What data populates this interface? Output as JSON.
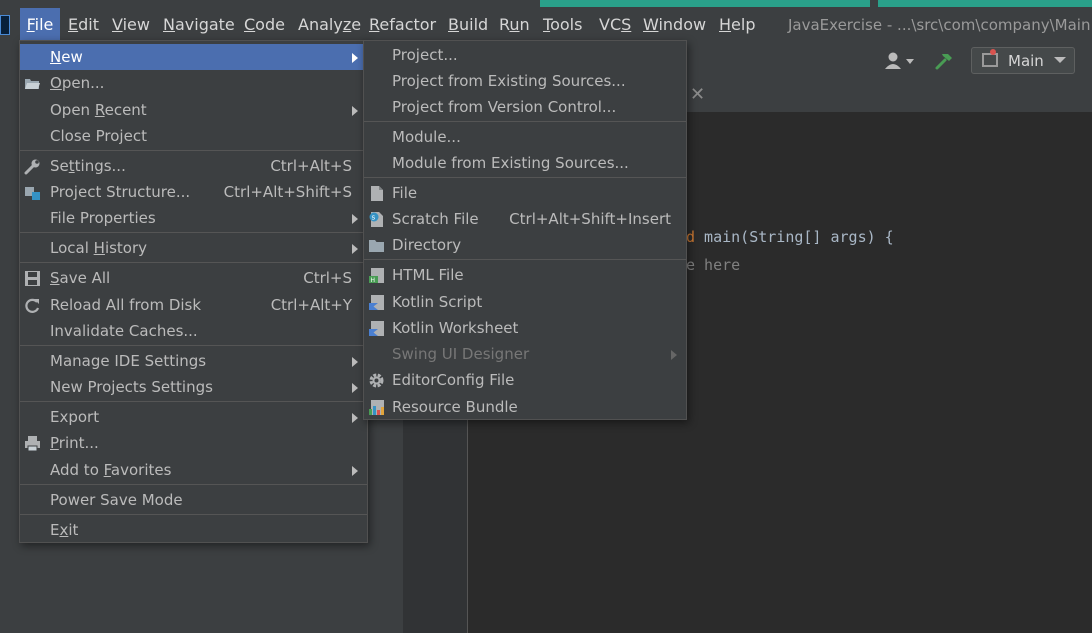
{
  "menubar": {
    "items": [
      {
        "label": "File",
        "underline": "F"
      },
      {
        "label": "Edit",
        "underline": "E"
      },
      {
        "label": "View",
        "underline": "V"
      },
      {
        "label": "Navigate",
        "underline": "N"
      },
      {
        "label": "Code",
        "underline": "C"
      },
      {
        "label": "Analyze",
        "underline": "z"
      },
      {
        "label": "Refactor",
        "underline": "R"
      },
      {
        "label": "Build",
        "underline": "B"
      },
      {
        "label": "Run",
        "underline": "u"
      },
      {
        "label": "Tools",
        "underline": "T"
      },
      {
        "label": "VCS",
        "underline": "S"
      },
      {
        "label": "Window",
        "underline": "W"
      },
      {
        "label": "Help",
        "underline": "H"
      }
    ],
    "window_title": "JavaExercise - ...\\src\\com\\company\\Main.j"
  },
  "toolbar": {
    "run_config": "Main"
  },
  "editor": {
    "code_keyword": "d",
    "code_main": " main(String[] args) {",
    "code_comment": "e here"
  },
  "file_menu": {
    "items": [
      {
        "label": "New",
        "pre": "",
        "u": "N",
        "post": "ew",
        "shortcut": "",
        "submenu": true
      },
      {
        "label": "Open...",
        "pre": "",
        "u": "O",
        "post": "pen...",
        "shortcut": "",
        "submenu": false
      },
      {
        "label": "Open Recent",
        "pre": "Open ",
        "u": "R",
        "post": "ecent",
        "shortcut": "",
        "submenu": true
      },
      {
        "label": "Close Project",
        "pre": "Close Pro",
        "u": "",
        "post": "ject",
        "shortcut": "",
        "submenu": false
      },
      {
        "label": "Settings...",
        "pre": "Se",
        "u": "t",
        "post": "tings...",
        "shortcut": "Ctrl+Alt+S",
        "submenu": false
      },
      {
        "label": "Project Structure...",
        "pre": "Project Structure...",
        "u": "",
        "post": "",
        "shortcut": "Ctrl+Alt+Shift+S",
        "submenu": false
      },
      {
        "label": "File Properties",
        "pre": "File Properties",
        "u": "",
        "post": "",
        "shortcut": "",
        "submenu": true
      },
      {
        "label": "Local History",
        "pre": "Local ",
        "u": "H",
        "post": "istory",
        "shortcut": "",
        "submenu": true
      },
      {
        "label": "Save All",
        "pre": "",
        "u": "S",
        "post": "ave All",
        "shortcut": "Ctrl+S",
        "submenu": false
      },
      {
        "label": "Reload All from Disk",
        "pre": "Reload All from Disk",
        "u": "",
        "post": "",
        "shortcut": "Ctrl+Alt+Y",
        "submenu": false
      },
      {
        "label": "Invalidate Caches...",
        "pre": "Invalidate Caches...",
        "u": "",
        "post": "",
        "shortcut": "",
        "submenu": false
      },
      {
        "label": "Manage IDE Settings",
        "pre": "Manage IDE Settings",
        "u": "",
        "post": "",
        "shortcut": "",
        "submenu": true
      },
      {
        "label": "New Projects Settings",
        "pre": "New Projects Settings",
        "u": "",
        "post": "",
        "shortcut": "",
        "submenu": true
      },
      {
        "label": "Export",
        "pre": "Export",
        "u": "",
        "post": "",
        "shortcut": "",
        "submenu": true
      },
      {
        "label": "Print...",
        "pre": "",
        "u": "P",
        "post": "rint...",
        "shortcut": "",
        "submenu": false
      },
      {
        "label": "Add to Favorites",
        "pre": "Add to ",
        "u": "F",
        "post": "avorites",
        "shortcut": "",
        "submenu": true
      },
      {
        "label": "Power Save Mode",
        "pre": "Power Save Mode",
        "u": "",
        "post": "",
        "shortcut": "",
        "submenu": false
      },
      {
        "label": "Exit",
        "pre": "E",
        "u": "x",
        "post": "it",
        "shortcut": "",
        "submenu": false
      }
    ]
  },
  "new_menu": {
    "items": [
      {
        "label": "Project...",
        "shortcut": "",
        "submenu": false,
        "disabled": false
      },
      {
        "label": "Project from Existing Sources...",
        "shortcut": "",
        "submenu": false,
        "disabled": false
      },
      {
        "label": "Project from Version Control...",
        "shortcut": "",
        "submenu": false,
        "disabled": false
      },
      {
        "label": "Module...",
        "shortcut": "",
        "submenu": false,
        "disabled": false
      },
      {
        "label": "Module from Existing Sources...",
        "shortcut": "",
        "submenu": false,
        "disabled": false
      },
      {
        "label": "File",
        "shortcut": "",
        "submenu": false,
        "disabled": false
      },
      {
        "label": "Scratch File",
        "shortcut": "Ctrl+Alt+Shift+Insert",
        "submenu": false,
        "disabled": false
      },
      {
        "label": "Directory",
        "shortcut": "",
        "submenu": false,
        "disabled": false
      },
      {
        "label": "HTML File",
        "shortcut": "",
        "submenu": false,
        "disabled": false
      },
      {
        "label": "Kotlin Script",
        "shortcut": "",
        "submenu": false,
        "disabled": false
      },
      {
        "label": "Kotlin Worksheet",
        "shortcut": "",
        "submenu": false,
        "disabled": false
      },
      {
        "label": "Swing UI Designer",
        "shortcut": "",
        "submenu": true,
        "disabled": true
      },
      {
        "label": "EditorConfig File",
        "shortcut": "",
        "submenu": false,
        "disabled": false
      },
      {
        "label": "Resource Bundle",
        "shortcut": "",
        "submenu": false,
        "disabled": false
      }
    ]
  }
}
